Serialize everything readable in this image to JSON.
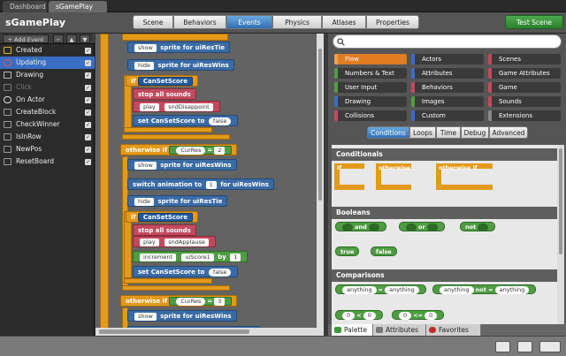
{
  "tabs": [
    {
      "label": "Dashboard"
    },
    {
      "label": "sGamePlay",
      "close": "×"
    }
  ],
  "game_title": "sGamePlay",
  "header_tabs": [
    "Scene",
    "Behaviors",
    "Events",
    "Physics",
    "Atlases",
    "Properties"
  ],
  "active_header_tab": "Events",
  "test_scene_label": "Test Scene",
  "sidebar": {
    "add_event_label": "+ Add Event",
    "minus_label": "−",
    "up_label": "▲",
    "down_label": "▼",
    "events": [
      {
        "label": "Created",
        "icon": "star-icon"
      },
      {
        "label": "Updating",
        "icon": "clock-icon",
        "selected": true
      },
      {
        "label": "Drawing",
        "icon": "brush-icon"
      },
      {
        "label": "Click",
        "icon": "mouse-icon",
        "dim": true
      },
      {
        "label": "On Actor",
        "icon": "actor-icon"
      },
      {
        "label": "CreateBlock",
        "icon": "block-icon"
      },
      {
        "label": "CheckWinner",
        "icon": "block-icon"
      },
      {
        "label": "IsInRow",
        "icon": "block-icon"
      },
      {
        "label": "NewPos",
        "icon": "block-icon"
      },
      {
        "label": "ResetBoard",
        "icon": "block-icon"
      }
    ],
    "check": "✓"
  },
  "canvas": {
    "show": "show",
    "hide": "hide",
    "sprite_for": "sprite for",
    "uiResTie": "uiResTie",
    "uiResWins": "uiResWins",
    "if": "if",
    "CanSetScore": "CanSetScore",
    "stop_all_sounds": "stop all sounds",
    "play": "play",
    "sndDisappoint": "sndDisappoint",
    "set_CanSetScore_to": "set CanSetScore to",
    "false": "false",
    "otherwise_if": "otherwise if",
    "CurRes": "CurRes",
    "eq": "=",
    "val2": "2",
    "val3": "3",
    "switch_animation_to": "switch animation to",
    "val1": "1",
    "for": "for",
    "sndApplause": "sndApplause",
    "increment": "increment",
    "uiScore1": "uiScore1",
    "by": "by",
    "one": "1"
  },
  "categories": [
    [
      "Flow",
      "Actors",
      "Scenes"
    ],
    [
      "Numbers & Text",
      "Attributes",
      "Game Attributes"
    ],
    [
      "User Input",
      "Behaviors",
      "Game"
    ],
    [
      "Drawing",
      "Images",
      "Sounds"
    ],
    [
      "Collisions",
      "Custom",
      "Extensions"
    ]
  ],
  "active_category": "Flow",
  "subtabs": [
    "Conditions",
    "Loops",
    "Time",
    "Debug",
    "Advanced"
  ],
  "active_subtab": "Conditions",
  "palette": {
    "conditionals_title": "Conditionals",
    "if": "if",
    "otherwise": "otherwise",
    "otherwise_if": "otherwise if",
    "booleans_title": "Booleans",
    "and": "and",
    "or": "or",
    "not": "not",
    "true": "true",
    "false": "false",
    "comparisons_title": "Comparisons",
    "anything": "anything",
    "eq": "=",
    "not_eq": "not =",
    "lt_left": "0",
    "lt": "<",
    "lt_right": "0",
    "le_left": "0",
    "le": "<=",
    "le_right": "0"
  },
  "bottom_tabs": [
    {
      "label": "Palette",
      "icon": "palette-icon"
    },
    {
      "label": "Attributes",
      "icon": "pencil-icon"
    },
    {
      "label": "Favorites",
      "icon": "heart-icon"
    }
  ],
  "colors": {
    "accent": "#3a6dc4",
    "flow": "#e07c22",
    "test_scene": "#2d7e2d"
  }
}
